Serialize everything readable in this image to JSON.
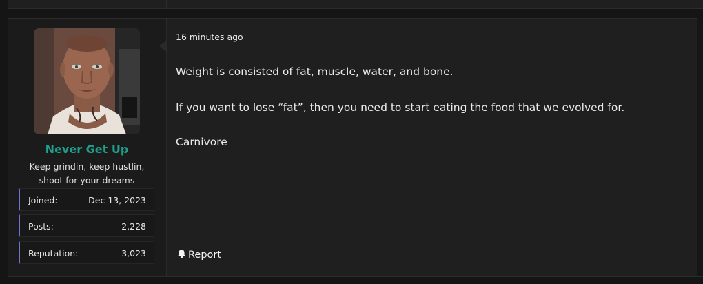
{
  "user": {
    "name": "Never Get Up",
    "title": "Keep grindin, keep hustlin, shoot for your dreams",
    "stats": [
      {
        "key": "Joined:",
        "value": "Dec 13, 2023"
      },
      {
        "key": "Posts:",
        "value": "2,228"
      },
      {
        "key": "Reputation:",
        "value": "3,023"
      }
    ]
  },
  "post": {
    "timestamp": "16 minutes ago",
    "paragraphs": [
      "Weight is consisted of fat, muscle, water, and bone.",
      "If you want to lose “fat”, then you need to start eating the food that we evolved for.",
      "Carnivore"
    ],
    "report_label": "Report"
  },
  "icons": {
    "report": "bell-icon"
  },
  "colors": {
    "username": "#1f9e8a",
    "stat_accent": "#6f74c9"
  }
}
